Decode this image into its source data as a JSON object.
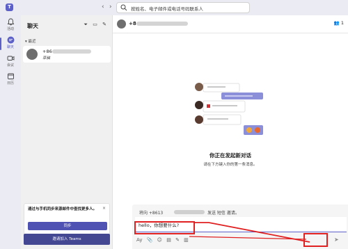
{
  "topbar": {
    "app_icon_letter": "T",
    "back_icon": "chevron-left-icon",
    "forward_icon": "chevron-right-icon",
    "search_placeholder": "按姓名、电子邮件或电话号码联系人"
  },
  "rail": {
    "items": [
      {
        "label": "活动",
        "icon": "bell-icon"
      },
      {
        "label": "聊天",
        "icon": "chat-icon",
        "active": true
      },
      {
        "label": "会议",
        "icon": "video-icon"
      },
      {
        "label": "日历",
        "icon": "calendar-icon"
      }
    ]
  },
  "list": {
    "title": "聊天",
    "recent_header": "▾ 最近",
    "chat": {
      "number": "+86",
      "subtitle": "草稿"
    },
    "invite_text": "通过与手机同步来源邮件中查找更多人。",
    "close": "×",
    "sync_button": "同步",
    "invite_button": "邀请加入 Teams"
  },
  "main": {
    "header_name": "+8",
    "people_count": "1",
    "empty_title": "你正在发起新对话",
    "empty_subtitle": "请在下方键入你的第一条消息。",
    "compose": {
      "hint_prefix": "将向 +8613",
      "hint_suffix": "发送 短信 邀请。",
      "input_value": "hello，你想要什么?",
      "tools": [
        "Ay",
        "📎",
        "☺",
        "▤",
        "✎",
        "▥",
        "⋯"
      ],
      "send_icon": "send-icon"
    }
  },
  "colors": {
    "accent": "#5b5fc7",
    "annotation": "#e02020"
  }
}
